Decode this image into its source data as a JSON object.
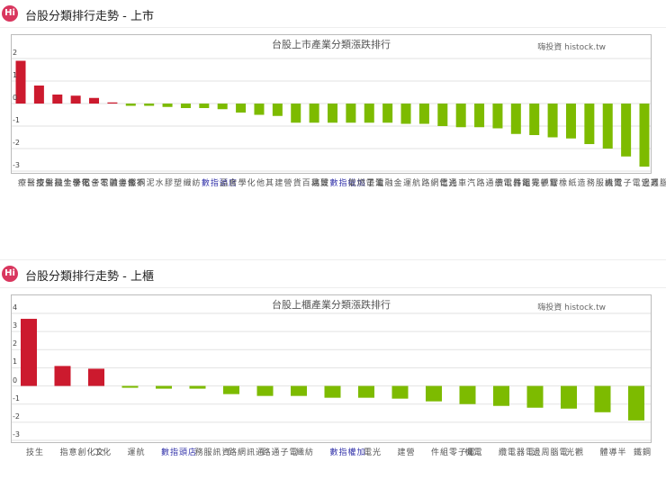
{
  "sections": [
    {
      "header": "台股分類排行走勢 - 上市",
      "logo": "Hi"
    },
    {
      "header": "台股分類排行走勢 - 上櫃",
      "logo": "Hi"
    }
  ],
  "chart_data": [
    {
      "type": "bar",
      "title": "台股上市產業分類漲跌排行",
      "credit": "嗨投資 histock.tw",
      "ylim": [
        -3,
        2
      ],
      "yticks": [
        2,
        1,
        0,
        -1,
        -2,
        -3
      ],
      "categories": [
        "生技醫療",
        "化學生技醫療",
        "不含金融",
        "不含電子",
        "不含金融電子",
        "半導體",
        "鋼鐵",
        "水泥",
        "塑膠",
        "紡織",
        "店頭指數",
        "食品",
        "化學",
        "其他",
        "營建",
        "貿易百貨",
        "玻璃",
        "加權指數",
        "油電燃氣",
        "電子",
        "金融",
        "航運",
        "通信網路",
        "光電",
        "汽車",
        "電子通路",
        "電器電纜",
        "電子零組件",
        "觀光",
        "橡膠",
        "造紙",
        "資訊服務",
        "電機",
        "其它電子",
        "電腦週邊"
      ],
      "values": [
        1.9,
        0.8,
        0.4,
        0.35,
        0.25,
        0.05,
        -0.1,
        -0.1,
        -0.15,
        -0.2,
        -0.2,
        -0.25,
        -0.4,
        -0.5,
        -0.55,
        -0.85,
        -0.85,
        -0.85,
        -0.85,
        -0.85,
        -0.85,
        -0.9,
        -0.9,
        -1.0,
        -1.05,
        -1.05,
        -1.1,
        -1.35,
        -1.4,
        -1.5,
        -1.55,
        -1.8,
        -2.0,
        -2.35,
        -2.8
      ],
      "index_categories": [
        "店頭指數",
        "加權指數"
      ],
      "colors": {
        "up": "#cc1a2e",
        "down": "#7dbb00",
        "index_label": "#3333aa"
      }
    },
    {
      "type": "bar",
      "title": "台股上櫃產業分類漲跌排行",
      "credit": "嗨投資 histock.tw",
      "ylim": [
        -3,
        4
      ],
      "yticks": [
        4,
        3,
        2,
        1,
        0,
        -1,
        -2,
        -3
      ],
      "categories": [
        "生技",
        "文化創意指",
        "化工",
        "航運",
        "店頭指數",
        "資訊服務",
        "通訊網路",
        "電子通路",
        "紡織",
        "加權指數",
        "光電",
        "營建",
        "電子零組件",
        "電機",
        "電器電纜",
        "電腦周邊",
        "觀光",
        "半導體",
        "鋼鐵"
      ],
      "values": [
        3.7,
        1.1,
        0.95,
        -0.1,
        -0.15,
        -0.15,
        -0.45,
        -0.55,
        -0.55,
        -0.65,
        -0.65,
        -0.7,
        -0.85,
        -1.0,
        -1.1,
        -1.2,
        -1.25,
        -1.45,
        -1.9
      ],
      "index_categories": [
        "店頭指數",
        "加權指數"
      ],
      "colors": {
        "up": "#cc1a2e",
        "down": "#7dbb00",
        "index_label": "#3333aa"
      }
    }
  ]
}
